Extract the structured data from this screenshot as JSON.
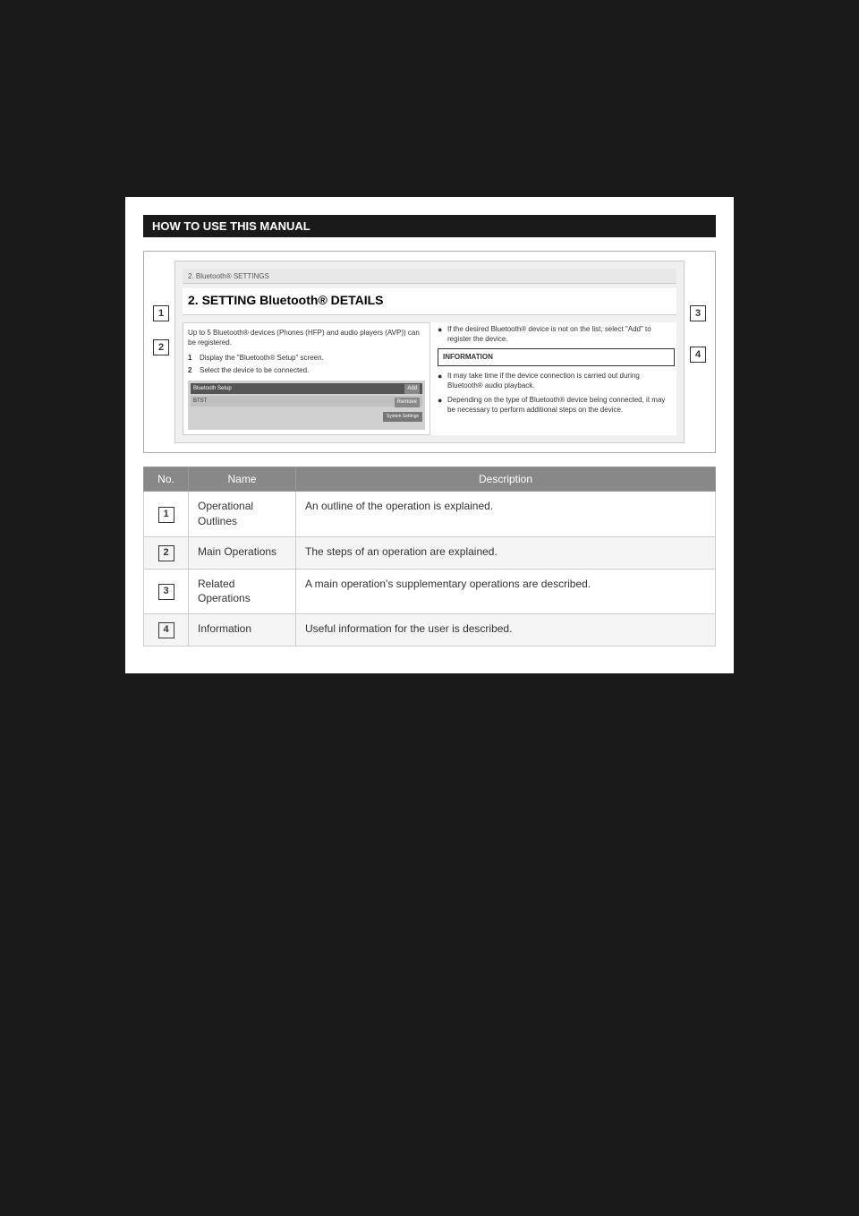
{
  "page": {
    "background_color": "#1a1a1a"
  },
  "section_header": {
    "label": "HOW TO USE THIS MANUAL"
  },
  "screenshot": {
    "title_bar": "2. Bluetooth® SETTINGS",
    "heading": "2. SETTING Bluetooth® DETAILS",
    "left_panel": {
      "outline_text": "Up to 5 Bluetooth® devices (Phones (HFP) and audio players (AVP)) can be registered.",
      "steps": [
        {
          "num": "1",
          "text": "Display the \"Bluetooth® Setup\" screen."
        },
        {
          "num": "2",
          "text": "Select the device to be connected."
        }
      ],
      "ui_label": "Bluetooth Setup",
      "ui_add": "Add",
      "ui_remove": "Remove",
      "ui_sys": "System Settings"
    },
    "right_panel": {
      "bullet1": "If the desired Bluetooth® device is not on the list, select \"Add\" to register the device.",
      "info_label": "INFORMATION",
      "bullet2": "It may take time if the device connection is carried out during Bluetooth® audio playback.",
      "bullet3": "Depending on the type of Bluetooth® device being connected, it may be necessary to perform additional steps on the device."
    }
  },
  "callouts": [
    "1",
    "2",
    "3",
    "4"
  ],
  "table": {
    "headers": [
      "No.",
      "Name",
      "Description"
    ],
    "rows": [
      {
        "no": "1",
        "name": "Operational Outlines",
        "description": "An outline of the operation is explained."
      },
      {
        "no": "2",
        "name": "Main Operations",
        "description": "The steps of an operation are explained."
      },
      {
        "no": "3",
        "name": "Related Operations",
        "description": "A main operation's supplementary operations are described."
      },
      {
        "no": "4",
        "name": "Information",
        "description": "Useful information for the user is described."
      }
    ]
  }
}
